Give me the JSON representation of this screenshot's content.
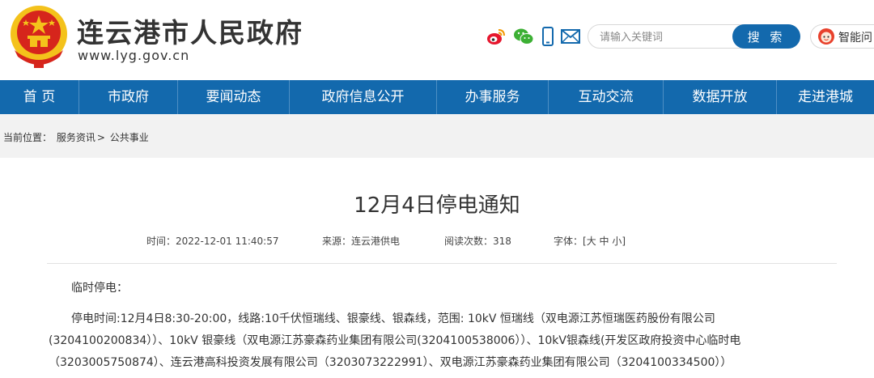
{
  "header": {
    "site_title": "连云港市人民政府",
    "site_url": "www.lyg.gov.cn",
    "social_icons": [
      "weibo-icon",
      "wechat-icon",
      "mobile-icon",
      "mail-icon"
    ],
    "search_placeholder": "请输入关键词",
    "search_button": "搜 索",
    "smart_label": "智能问",
    "colors": {
      "primary_blue": "#1369ad",
      "emblem_red": "#d6251c",
      "emblem_gold": "#f4c21b"
    }
  },
  "nav": {
    "items": [
      {
        "label": "首 页"
      },
      {
        "label": "市政府"
      },
      {
        "label": "要闻动态"
      },
      {
        "label": "政府信息公开"
      },
      {
        "label": "办事服务"
      },
      {
        "label": "互动交流"
      },
      {
        "label": "数据开放"
      },
      {
        "label": "走进港城"
      }
    ]
  },
  "breadcrumb": {
    "prefix": "当前位置：",
    "level1": "服务资讯",
    "separator": ">",
    "level2": "公共事业"
  },
  "article": {
    "title": "12月4日停电通知",
    "meta": {
      "time_label": "时间：",
      "time_value": "2022-12-01 11:40:57",
      "source_label": "来源：",
      "source_value": "连云港供电",
      "views_label": "阅读次数：",
      "views_value": "318",
      "font_label": "字体：",
      "font_open": "[",
      "font_large": "大",
      "font_medium": "中",
      "font_small": "小",
      "font_close": "]"
    },
    "paragraphs": [
      "临时停电：",
      "停电时间:12月4日8:30-20:00，线路:10千伏恒瑞线、银豪线、银森线，范围: 10kV 恒瑞线（双电源江苏恒瑞医药股份有限公司",
      "(3204100200834））、10kV 银豪线（双电源江苏豪森药业集团有限公司(3204100538006））、10kV银森线(开发区政府投资中心临时电",
      "（3203005750874）、连云港高科投资发展有限公司（3203073222991）、双电源江苏豪森药业集团有限公司（3204100334500））"
    ]
  }
}
